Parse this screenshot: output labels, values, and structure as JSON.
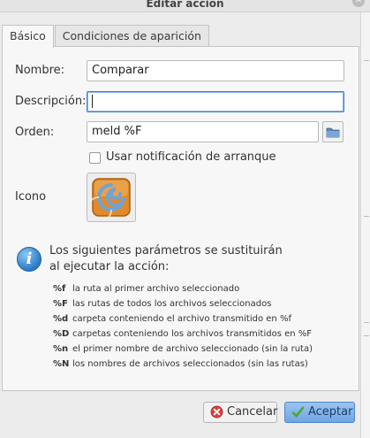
{
  "window": {
    "title": "Editar acción"
  },
  "tabs": [
    {
      "label": "Básico",
      "active": true
    },
    {
      "label": "Condiciones de aparición",
      "active": false
    }
  ],
  "form": {
    "name_label": "Nombre:",
    "name_value": "Comparar",
    "description_label": "Descripción:",
    "description_value": "",
    "command_label": "Orden:",
    "command_value": "meld %F",
    "startup_notify_label": "Usar notificación de arranque",
    "startup_notify_checked": false,
    "icon_label": "Icono"
  },
  "info": {
    "line1": "Los siguientes parámetros se sustituirán",
    "line2": "al ejecutar la acción:",
    "params": [
      {
        "code": "%f",
        "desc": "la ruta al primer archivo seleccionado"
      },
      {
        "code": "%F",
        "desc": "las rutas de todos los archivos seleccionados"
      },
      {
        "code": "%d",
        "desc": "carpeta conteniendo el archivo transmitido en %f"
      },
      {
        "code": "%D",
        "desc": "carpetas conteniendo los archivos transmitidos en %F"
      },
      {
        "code": "%n",
        "desc": "el primer nombre de archivo seleccionado (sin la ruta)"
      },
      {
        "code": "%N",
        "desc": "los nombres de archivos seleccionados (sin las rutas)"
      }
    ]
  },
  "buttons": {
    "cancel": "Cancelar",
    "ok": "Aceptar"
  },
  "colors": {
    "accent": "#3b7fd1",
    "info_icon": "#2a7bc4",
    "ok_button": "#6fa5e3"
  }
}
